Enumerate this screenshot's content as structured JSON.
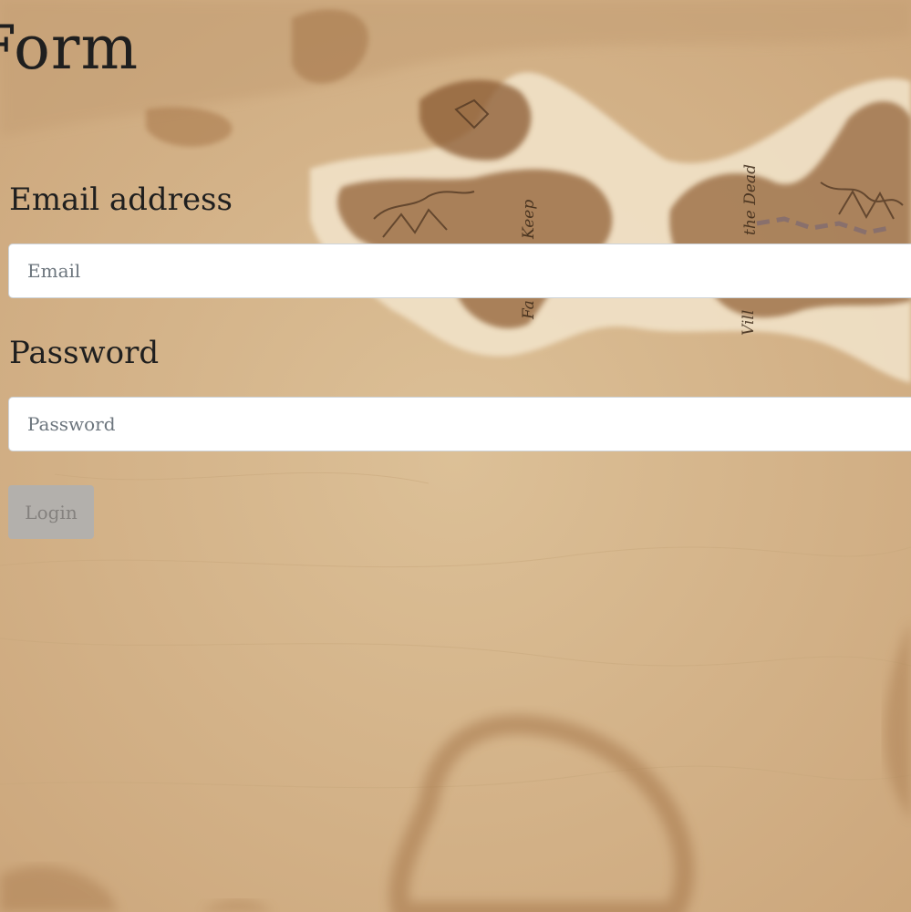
{
  "page": {
    "title": "Form",
    "background": "parchment-map"
  },
  "form": {
    "email": {
      "label": "Email address",
      "placeholder": "Email",
      "value": ""
    },
    "password": {
      "label": "Password",
      "placeholder": "Password",
      "value": ""
    },
    "submit_label": "Login"
  },
  "map": {
    "labels": [
      "Keep",
      "Fa",
      "the Dead",
      "Vill"
    ]
  },
  "colors": {
    "parchment": "#d7b88c",
    "ink": "#1f1f1f",
    "button_bg": "#b3b0ac",
    "button_text": "#84817e",
    "input_bg": "#ffffff"
  }
}
